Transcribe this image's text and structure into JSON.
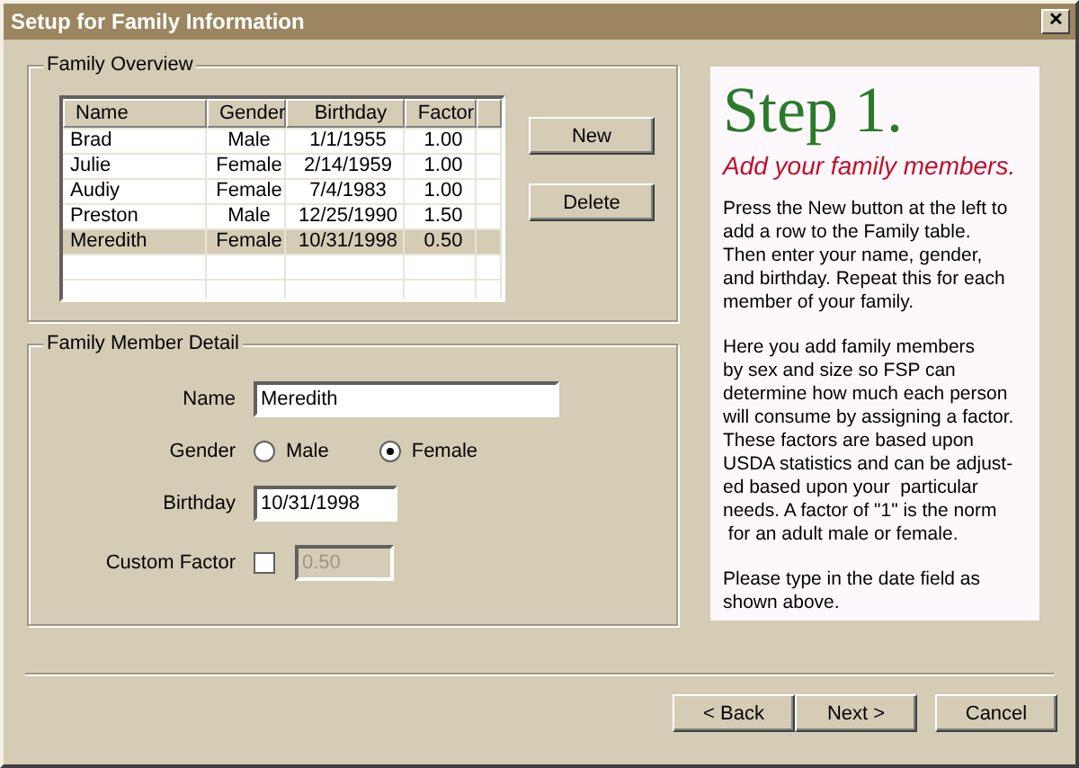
{
  "window": {
    "title": "Setup for Family Information",
    "close": "✕"
  },
  "overview": {
    "legend": "Family Overview",
    "columns": [
      "Name",
      "Gender",
      "Birthday",
      "Factor"
    ],
    "rows": [
      {
        "cells": [
          "Brad",
          "Male",
          "1/1/1955",
          "1.00"
        ],
        "selected": false
      },
      {
        "cells": [
          "Julie",
          "Female",
          "2/14/1959",
          "1.00"
        ],
        "selected": false
      },
      {
        "cells": [
          "Audiy",
          "Female",
          "7/4/1983",
          "1.00"
        ],
        "selected": false
      },
      {
        "cells": [
          "Preston",
          "Male",
          "12/25/1990",
          "1.50"
        ],
        "selected": false
      },
      {
        "cells": [
          "Meredith",
          "Female",
          "10/31/1998",
          "0.50"
        ],
        "selected": true
      }
    ],
    "buttons": [
      "New",
      "Delete"
    ]
  },
  "detail": {
    "legend": "Family Member Detail",
    "name_label": "Name",
    "name_value": "Meredith",
    "gender_label": "Gender",
    "genders": [
      {
        "label": "Male",
        "selected": false
      },
      {
        "label": "Female",
        "selected": true
      }
    ],
    "birthday_label": "Birthday",
    "birthday_value": "10/31/1998",
    "custom_label": "Custom Factor",
    "custom_checked": false,
    "custom_value": "0.50",
    "custom_disabled": true
  },
  "help": {
    "heading": "Step 1.",
    "subheading": "Add your family members.",
    "paragraphs": [
      "Press the New button at the left to\nadd a row to the Family table.\nThen enter your name, gender,\nand birthday. Repeat this for each\nmember of your family.",
      "Here you add family members\nby sex and size so FSP can\ndetermine how much each person\nwill consume by assigning a factor.\nThese factors are based upon\nUSDA statistics and can be adjust-\ned based upon your  particular\nneeds. A factor of \"1\" is the norm\n for an adult male or female.",
      "Please type in the date field as\nshown above."
    ]
  },
  "footer": {
    "buttons": [
      "< Back",
      "Next >",
      "Cancel"
    ]
  }
}
